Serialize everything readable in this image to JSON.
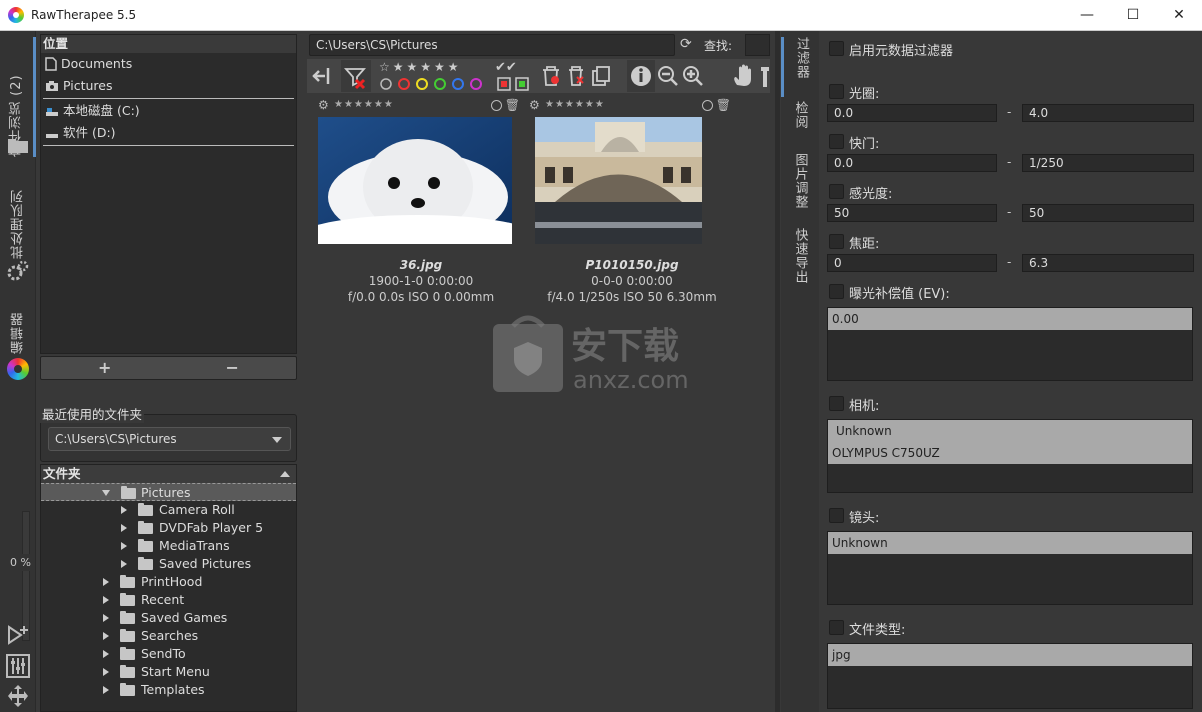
{
  "window": {
    "title": "RawTherapee 5.5",
    "minimize": "—",
    "maximize": "☐",
    "close": "✕"
  },
  "left_tabs": {
    "file_browser": "文件浏览 (2)",
    "batch_queue": "批处理队列",
    "editor": "编辑器",
    "progress": "0 %"
  },
  "places": {
    "header": "位置",
    "items": [
      "Documents",
      "Pictures"
    ],
    "drives": [
      "本地磁盘 (C:)",
      "软件 (D:)"
    ],
    "add": "+",
    "remove": "−"
  },
  "recent": {
    "label": "最近使用的文件夹",
    "value": "C:\\Users\\CS\\Pictures"
  },
  "folders": {
    "header": "文件夹",
    "selected": "Pictures",
    "children": [
      "Camera Roll",
      "DVDFab Player 5",
      "MediaTrans",
      "Saved Pictures"
    ],
    "siblings": [
      "PrintHood",
      "Recent",
      "Saved Games",
      "Searches",
      "SendTo",
      "Start Menu",
      "Templates"
    ]
  },
  "browser": {
    "path": "C:\\Users\\CS\\Pictures",
    "search_label": "查找:",
    "thumbnails": [
      {
        "name": "36.jpg",
        "date": "1900-1-0 0:00:00",
        "exif": "f/0.0 0.0s ISO 0 0.00mm"
      },
      {
        "name": "P1010150.jpg",
        "date": "0-0-0 0:00:00",
        "exif": "f/4.0 1/250s ISO 50 6.30mm"
      }
    ],
    "watermark": "安下载 anxz.com"
  },
  "right_tabs": {
    "filter": "过滤器",
    "inspect": "检阅",
    "image_adjust": "图片调整",
    "fast_export": "快速导出"
  },
  "filters": {
    "enable_metadata": "启用元数据过滤器",
    "aperture": {
      "label": "光圈:",
      "min": "0.0",
      "max": "4.0"
    },
    "shutter": {
      "label": "快门:",
      "min": "0.0",
      "max": "1/250"
    },
    "iso": {
      "label": "感光度:",
      "min": "50",
      "max": "50"
    },
    "focal": {
      "label": "焦距:",
      "min": "0",
      "max": "6.3"
    },
    "ev": {
      "label": "曝光补偿值 (EV):",
      "options": [
        "0.00"
      ]
    },
    "camera": {
      "label": "相机:",
      "options": [
        "Unknown",
        "OLYMPUS C750UZ"
      ]
    },
    "lens": {
      "label": "镜头:",
      "options": [
        "Unknown"
      ]
    },
    "filetype": {
      "label": "文件类型:",
      "options": [
        "jpg"
      ]
    },
    "range_dash": "-"
  }
}
